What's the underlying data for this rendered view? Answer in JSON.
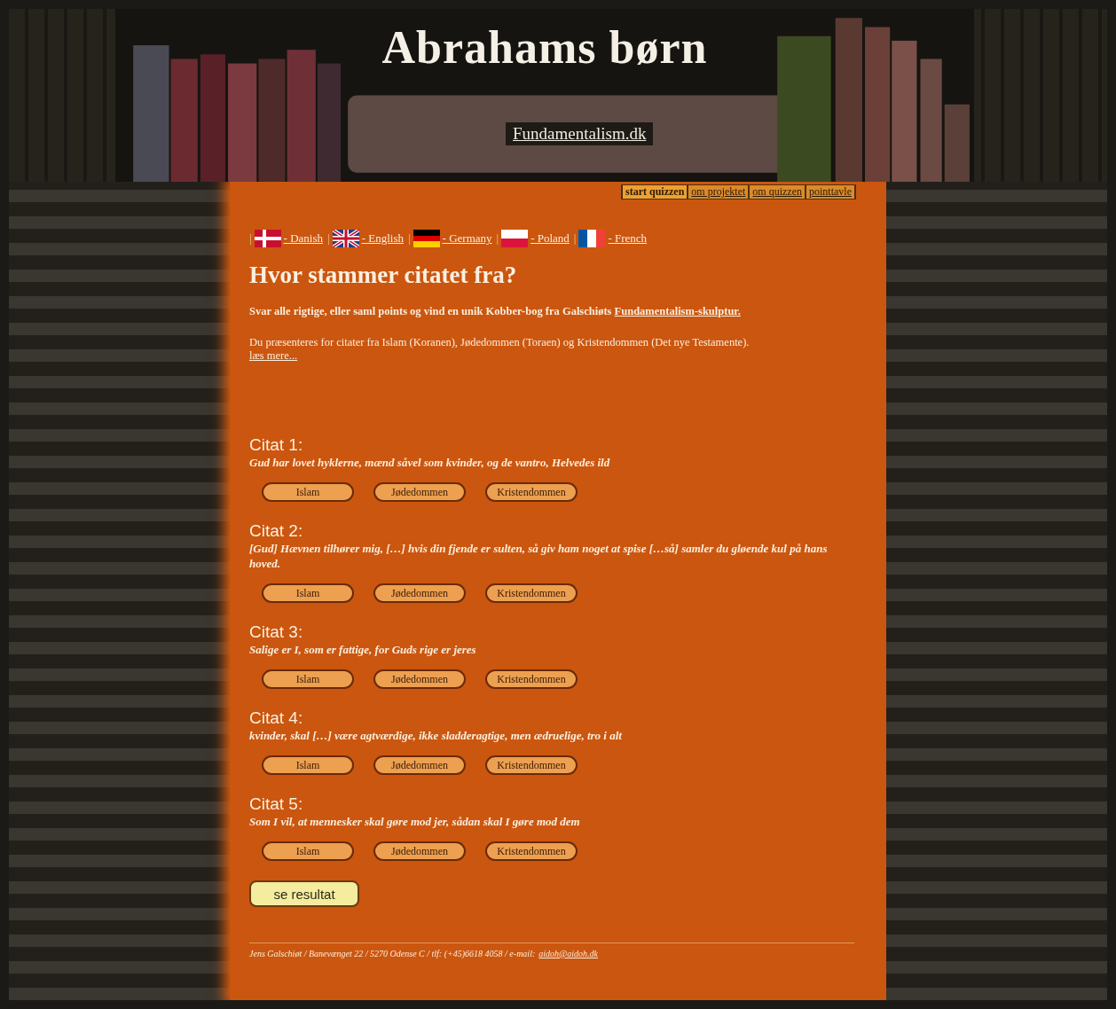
{
  "header": {
    "title": "Abrahams børn",
    "subtitle_link": "Fundamentalism.dk"
  },
  "nav": [
    {
      "label": "start quizzen",
      "selected": true
    },
    {
      "label": "om projektet",
      "selected": false
    },
    {
      "label": "om quizzen",
      "selected": false
    },
    {
      "label": "pointtavle",
      "selected": false
    }
  ],
  "languages": [
    {
      "sep": "|",
      "kind": "dk",
      "label": "- Danish"
    },
    {
      "sep": "|",
      "kind": "uk",
      "label": "- English"
    },
    {
      "sep": "|",
      "kind": "de",
      "label": "- Germany"
    },
    {
      "sep": "|",
      "kind": "pl",
      "label": "- Poland"
    },
    {
      "sep": "|",
      "kind": "fr",
      "label": "- French"
    }
  ],
  "heading": "Hvor stammer citatet fra?",
  "intro": {
    "text": "Svar alle rigtige, eller saml points og vind en unik Kobber-bog fra Galschiøts",
    "link": "Fundamentalism-skulptur."
  },
  "description": {
    "text": "Du præsenteres for citater fra Islam (Koranen), Jødedommen (Toraen) og Kristendommen (Det nye Testamente).",
    "link": "læs mere..."
  },
  "quotes": [
    {
      "label": "Citat 1:",
      "text": "Gud har lovet hyklerne, mænd såvel som kvinder, og de vantro, Helvedes ild",
      "options": [
        "Islam",
        "Jødedommen",
        "Kristendommen"
      ]
    },
    {
      "label": "Citat 2:",
      "text": "[Gud] Hævnen tilhører mig, […] hvis din fjende er sulten, så giv ham noget at spise […så] samler du gløende kul på hans hoved.",
      "options": [
        "Islam",
        "Jødedommen",
        "Kristendommen"
      ]
    },
    {
      "label": "Citat 3:",
      "text": "Salige er I, som er fattige, for Guds rige er jeres",
      "options": [
        "Islam",
        "Jødedommen",
        "Kristendommen"
      ]
    },
    {
      "label": "Citat 4:",
      "text": "kvinder, skal […] være agtværdige, ikke sladderagtige, men ædruelige, tro i alt",
      "options": [
        "Islam",
        "Jødedommen",
        "Kristendommen"
      ]
    },
    {
      "label": "Citat 5:",
      "text": "Som I vil, at mennesker skal gøre mod jer, sådan skal I gøre mod dem",
      "options": [
        "Islam",
        "Jødedommen",
        "Kristendommen"
      ]
    }
  ],
  "result_button": "se resultat",
  "footer": {
    "text": "Jens Galschiøt / Banevænget 22 / 5270 Odense C / tlf: (+45)6618 4058 / e-mail:",
    "link": "aidoh@aidoh.dk"
  }
}
